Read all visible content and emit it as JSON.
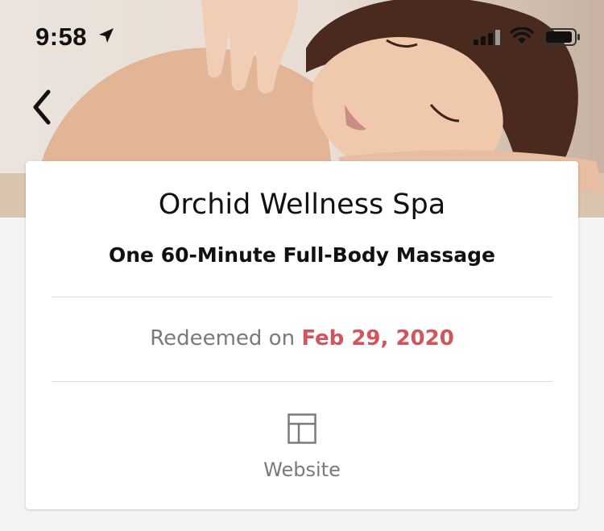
{
  "status_bar": {
    "time": "9:58"
  },
  "header": {
    "back_icon": "chevron-left-icon",
    "hero_image": "spa-massage-photo"
  },
  "voucher": {
    "merchant_name": "Orchid Wellness Spa",
    "deal_title": "One 60-Minute Full-Body Massage",
    "redeemed_label": "Redeemed on",
    "redeemed_date": "Feb 29, 2020",
    "website_label": "Website",
    "website_icon": "layout-icon"
  },
  "colors": {
    "accent": "#d4545c",
    "muted_text": "#7a7a7a",
    "background": "#f4f4f6"
  }
}
